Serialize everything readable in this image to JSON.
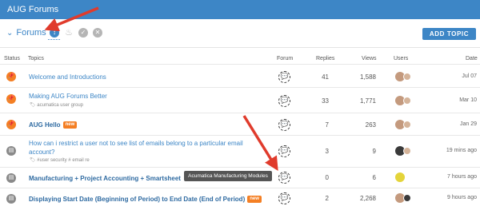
{
  "app": {
    "title": "AUG Forums"
  },
  "toolbar": {
    "forums_label": "Forums",
    "add_topic_label": "ADD TOPIC",
    "filters": [
      {
        "name": "latest-filter-icon",
        "glyph": "↕",
        "active": true
      },
      {
        "name": "hot-filter-icon",
        "glyph": "🔥",
        "active": false
      },
      {
        "name": "resolved-filter-icon",
        "glyph": "✔",
        "active": false
      },
      {
        "name": "unresolved-filter-icon",
        "glyph": "✖",
        "active": false
      }
    ]
  },
  "table": {
    "headers": {
      "status": "Status",
      "topics": "Topics",
      "forum": "Forum",
      "replies": "Replies",
      "views": "Views",
      "users": "Users",
      "date": "Date"
    },
    "rows": [
      {
        "status": "pinned",
        "title": "Welcome and Introductions",
        "tags": "",
        "badge": "",
        "replies": "41",
        "views": "1,588",
        "date": "Jul 07"
      },
      {
        "status": "pinned",
        "title": "Making AUG Forums Better",
        "tags": "acumatica user group",
        "badge": "",
        "replies": "33",
        "views": "1,771",
        "date": "Mar 10"
      },
      {
        "status": "pinned",
        "title": "AUG Hello",
        "tags": "",
        "badge": "new",
        "replies": "7",
        "views": "263",
        "date": "Jan 29"
      },
      {
        "status": "doc",
        "title": "How can i restrict a user not to see list of emails belong to a particular email account?",
        "tags": "#user security # email re",
        "badge": "",
        "replies": "3",
        "views": "9",
        "date": "19 mins ago"
      },
      {
        "status": "doc",
        "title": "Manufacturing + Project Accounting + Smartsheet",
        "tags": "",
        "badge": "",
        "replies": "0",
        "views": "6",
        "date": "7 hours ago"
      },
      {
        "status": "doc",
        "title": "Displaying Start Date (Beginning of Period) to End Date (End of Period)",
        "tags": "",
        "badge": "new",
        "replies": "2",
        "views": "2,268",
        "date": "9 hours ago"
      }
    ]
  },
  "tooltip": {
    "text": "Acumatica Manufacturing Modules"
  },
  "colors": {
    "brand": "#3d86c6",
    "pin": "#f47f24",
    "annotation": "#e03b2c"
  }
}
